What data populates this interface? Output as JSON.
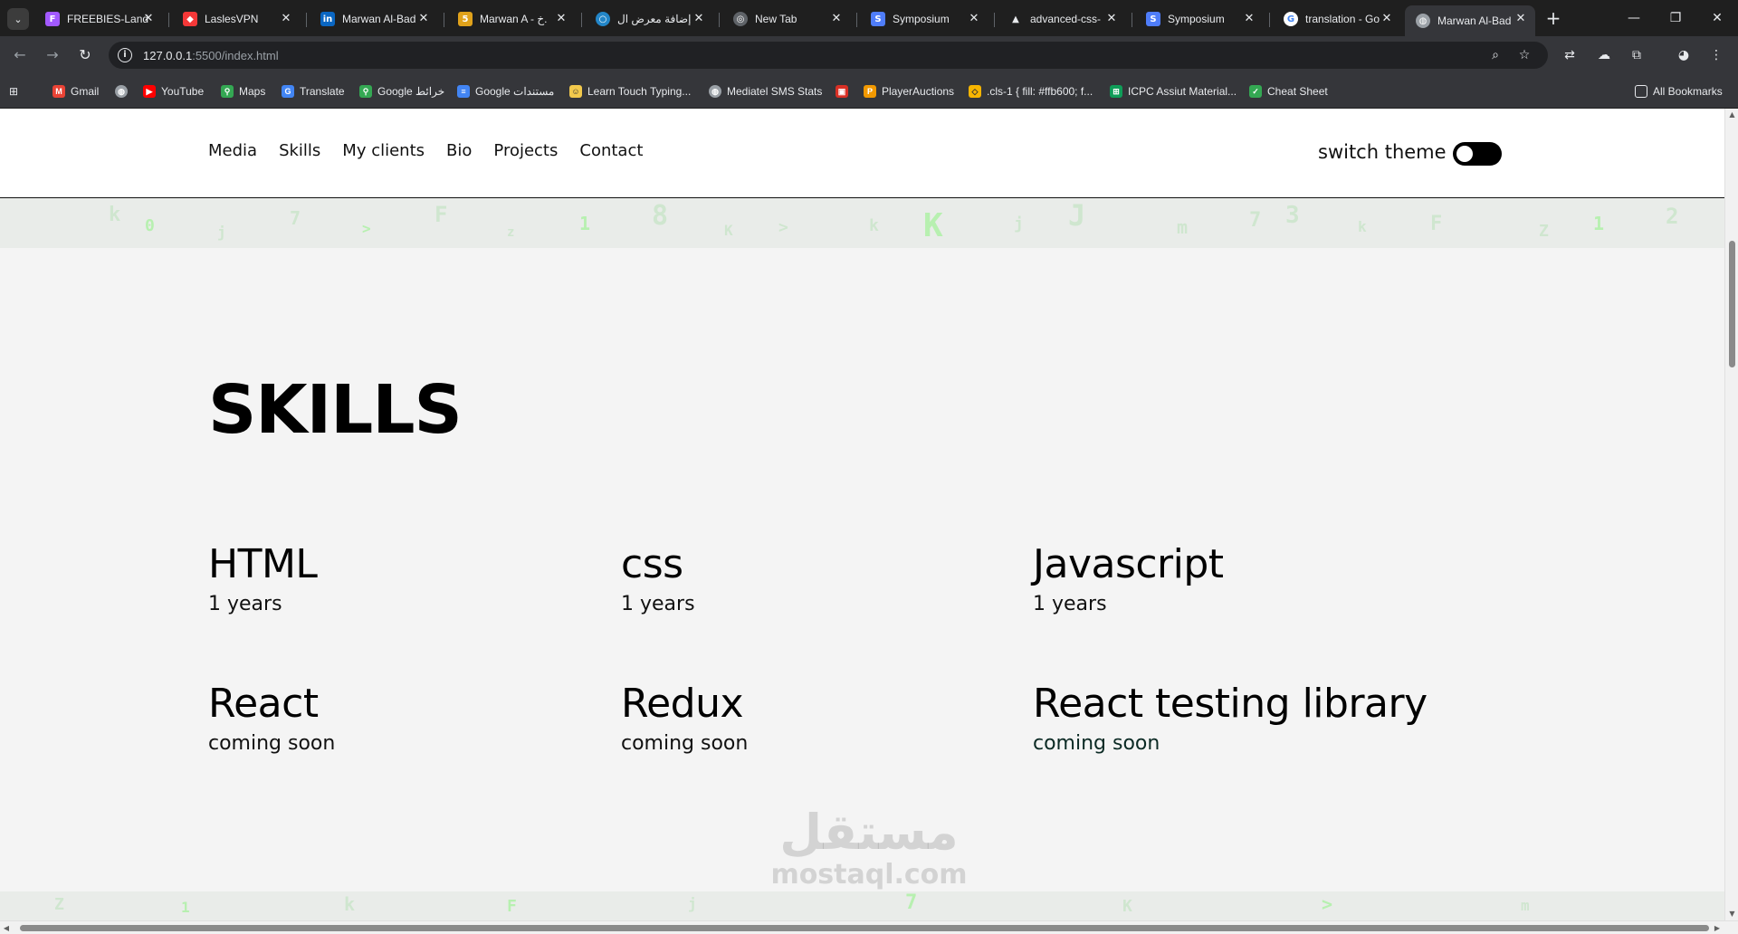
{
  "browser": {
    "tabs": [
      {
        "title": "FREEBIES-Land",
        "icon": "figma-icon",
        "color": "#a259ff"
      },
      {
        "title": "LaslesVPN",
        "icon": "vpn-icon",
        "color": "#f53838"
      },
      {
        "title": "Marwan Al-Bad",
        "icon": "linkedin-icon",
        "color": "#0a66c2"
      },
      {
        "title": "Marwan A - خ.",
        "icon": "khamsat-icon",
        "color": "#e0a21b"
      },
      {
        "title": "إضافة معرض ال",
        "icon": "mostaql-icon",
        "color": "#2386c8"
      },
      {
        "title": "New Tab",
        "icon": "chrome-icon",
        "color": "#8ab4f8"
      },
      {
        "title": "Symposium",
        "icon": "symposium-icon",
        "color": "#4f7df9"
      },
      {
        "title": "advanced-css-",
        "icon": "drive-icon",
        "color": "#e8eaed"
      },
      {
        "title": "Symposium",
        "icon": "symposium-icon",
        "color": "#4f7df9"
      },
      {
        "title": "translation - Go",
        "icon": "google-icon",
        "color": "#4285f4"
      },
      {
        "title": "Marwan Al-Bad",
        "icon": "globe-icon",
        "color": "#9aa0a6"
      }
    ],
    "active_tab_index": 10,
    "url_host": "127.0.0.1",
    "url_path": ":5500/index.html",
    "bookmarks": [
      {
        "label": "Gmail",
        "icon": "gmail-icon",
        "color": "#ea4335"
      },
      {
        "label": "",
        "icon": "globe-icon",
        "color": "#9aa0a6"
      },
      {
        "label": "YouTube",
        "icon": "youtube-icon",
        "color": "#ff0000"
      },
      {
        "label": "Maps",
        "icon": "maps-icon",
        "color": "#34a853"
      },
      {
        "label": "Translate",
        "icon": "translate-icon",
        "color": "#4285f4"
      },
      {
        "label": "Google خرائط",
        "icon": "maps-icon",
        "color": "#34a853"
      },
      {
        "label": "Google مستندات",
        "icon": "docs-icon",
        "color": "#4285f4"
      },
      {
        "label": "Learn Touch Typing...",
        "icon": "typing-icon",
        "color": "#f2c94c"
      },
      {
        "label": "Mediatel SMS Stats",
        "icon": "globe-icon",
        "color": "#9aa0a6"
      },
      {
        "label": "",
        "icon": "red-square-icon",
        "color": "#d93025"
      },
      {
        "label": "PlayerAuctions",
        "icon": "playerauctions-icon",
        "color": "#f29900"
      },
      {
        "label": ".cls-1 { fill: #ffb600; f...",
        "icon": "sketch-icon",
        "color": "#f7b500"
      },
      {
        "label": "ICPC Assiut Material...",
        "icon": "sheets-icon",
        "color": "#0f9d58"
      },
      {
        "label": "Cheat Sheet",
        "icon": "cheatsheet-icon",
        "color": "#34a853"
      }
    ],
    "all_bookmarks": "All Bookmarks"
  },
  "site": {
    "nav": [
      "Media",
      "Skills",
      "My clients",
      "Bio",
      "Projects",
      "Contact"
    ],
    "switch_theme": "switch theme",
    "skills_title": "SKILLS",
    "skills": [
      {
        "name": "HTML",
        "years": "1 years"
      },
      {
        "name": "css",
        "years": "1 years"
      },
      {
        "name": "Javascript",
        "years": "1 years"
      },
      {
        "name": "React",
        "years": "coming soon"
      },
      {
        "name": "Redux",
        "years": "coming soon"
      },
      {
        "name": "React testing library",
        "years": "coming soon"
      }
    ],
    "watermark_ar": "مستقل",
    "watermark_lat": "mostaql.com"
  }
}
